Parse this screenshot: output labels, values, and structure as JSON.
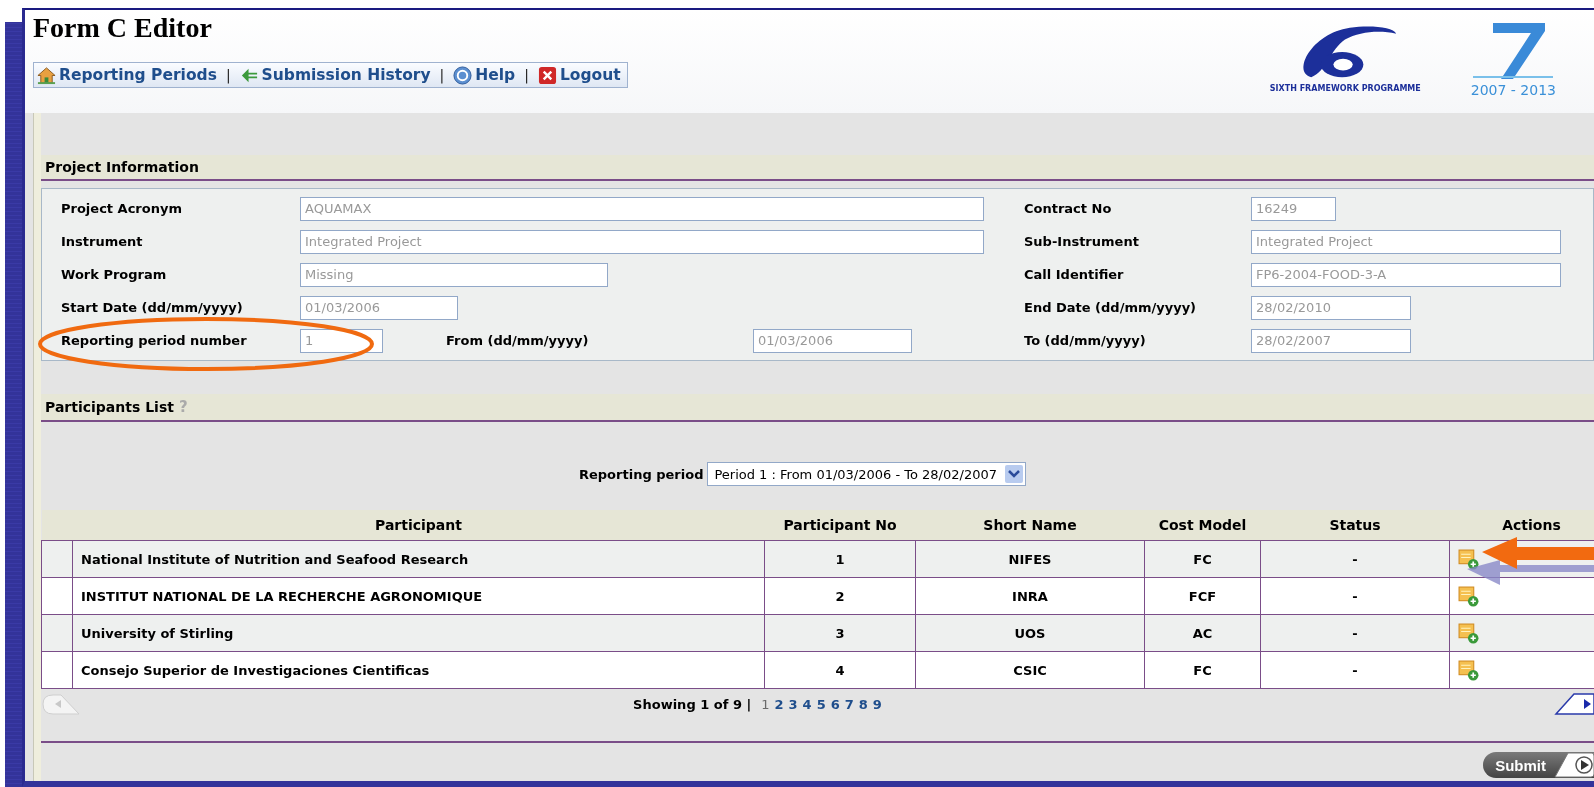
{
  "window": {
    "title": "Form C Editor"
  },
  "nav_separator": "|",
  "nav": [
    {
      "kind": "home",
      "label": "Reporting Periods"
    },
    {
      "kind": "history",
      "label": "Submission History"
    },
    {
      "kind": "help",
      "label": "Help"
    },
    {
      "kind": "logout",
      "label": "Logout"
    }
  ],
  "logos": [
    {
      "kind": "fp6",
      "caption": "SIXTH FRAMEWORK PROGRAMME"
    },
    {
      "kind": "fp7",
      "caption": "2007 - 2013"
    }
  ],
  "project_information": {
    "title": "Project Information",
    "rows": [
      {
        "left": {
          "label": "Project Acronym",
          "value": "AQUAMAX"
        },
        "right": {
          "label": "Contract No",
          "value": "16249"
        }
      },
      {
        "left": {
          "label": "Instrument",
          "value": "Integrated Project"
        },
        "right": {
          "label": "Sub-Instrument",
          "value": "Integrated Project"
        }
      },
      {
        "left": {
          "label": "Work Program",
          "value": "Missing"
        },
        "right": {
          "label": "Call Identifier",
          "value": "FP6-2004-FOOD-3-A"
        }
      },
      {
        "left": {
          "label": "Start Date (dd/mm/yyyy)",
          "value": "01/03/2006"
        },
        "right": {
          "label": "End Date (dd/mm/yyyy)",
          "value": "28/02/2010"
        }
      },
      {
        "left": {
          "label": "Reporting period number",
          "value": "1"
        },
        "middle": {
          "label": "From (dd/mm/yyyy)",
          "value": "01/03/2006"
        },
        "right": {
          "label": "To (dd/mm/yyyy)",
          "value": "28/02/2007"
        }
      }
    ]
  },
  "participants_list": {
    "title": "Participants List",
    "help": "?",
    "reporting_period": {
      "label": "Reporting period",
      "value": "Period 1 : From 01/03/2006 - To 28/02/2007"
    },
    "table": {
      "columns": [
        "Participant",
        "Participant No",
        "Short Name",
        "Cost Model",
        "Status",
        "Actions"
      ],
      "rows": [
        {
          "participant": "National Institute of Nutrition and Seafood Research",
          "participant_no": "1",
          "short_name": "NIFES",
          "cost_model": "FC",
          "status": "-"
        },
        {
          "participant": "INSTITUT NATIONAL DE LA RECHERCHE AGRONOMIQUE",
          "participant_no": "2",
          "short_name": "INRA",
          "cost_model": "FCF",
          "status": "-"
        },
        {
          "participant": "University of Stirling",
          "participant_no": "3",
          "short_name": "UOS",
          "cost_model": "AC",
          "status": "-"
        },
        {
          "participant": "Consejo Superior de Investigaciones Cientificas",
          "participant_no": "4",
          "short_name": "CSIC",
          "cost_model": "FC",
          "status": "-"
        }
      ]
    },
    "pagination": {
      "summary": "Showing 1 of 9 |",
      "pages": [
        {
          "label": "1",
          "selected": true
        },
        {
          "label": "2",
          "selected": false
        },
        {
          "label": "3",
          "selected": false
        },
        {
          "label": "4",
          "selected": false
        },
        {
          "label": "5",
          "selected": false
        },
        {
          "label": "6",
          "selected": false
        },
        {
          "label": "7",
          "selected": false
        },
        {
          "label": "8",
          "selected": false
        },
        {
          "label": "9",
          "selected": false
        }
      ]
    }
  },
  "submit": {
    "label": "Submit"
  }
}
